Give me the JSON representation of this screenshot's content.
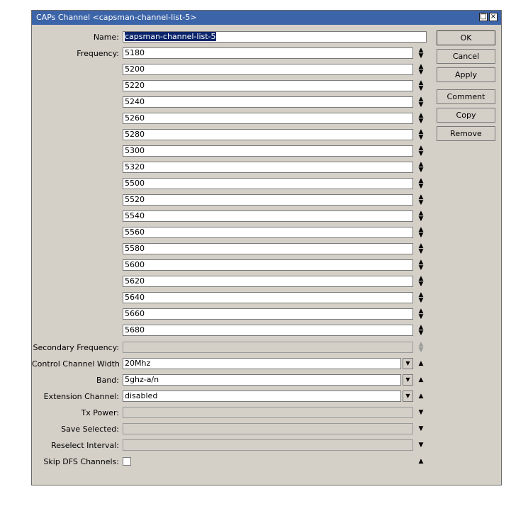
{
  "window": {
    "title": "CAPs Channel <capsman-channel-list-5>",
    "maximize_glyph": "□",
    "close_glyph": "×"
  },
  "labels": {
    "name": "Name:",
    "frequency": "Frequency:",
    "secondary_frequency": "Secondary Frequency:",
    "control_channel_width": "Control Channel Width",
    "band": "Band:",
    "extension_channel": "Extension Channel:",
    "tx_power": "Tx Power:",
    "save_selected": "Save Selected:",
    "reselect_interval": "Reselect Interval:",
    "skip_dfs_channels": "Skip DFS Channels:"
  },
  "fields": {
    "name": "capsman-channel-list-5",
    "frequencies": [
      "5180",
      "5200",
      "5220",
      "5240",
      "5260",
      "5280",
      "5300",
      "5320",
      "5500",
      "5520",
      "5540",
      "5560",
      "5580",
      "5600",
      "5620",
      "5640",
      "5660",
      "5680"
    ],
    "secondary_frequency": "",
    "control_channel_width": "20Mhz",
    "band": "5ghz-a/n",
    "extension_channel": "disabled",
    "tx_power": "",
    "save_selected": "",
    "reselect_interval": "",
    "skip_dfs_channels": false
  },
  "buttons": {
    "ok": "OK",
    "cancel": "Cancel",
    "apply": "Apply",
    "comment": "Comment",
    "copy": "Copy",
    "remove": "Remove"
  },
  "icons": {
    "spin": "updown-arrows-icon",
    "dropdown": "dropdown-arrow-icon",
    "expand_up": "triangle-up-icon",
    "expand_down": "triangle-down-icon"
  }
}
